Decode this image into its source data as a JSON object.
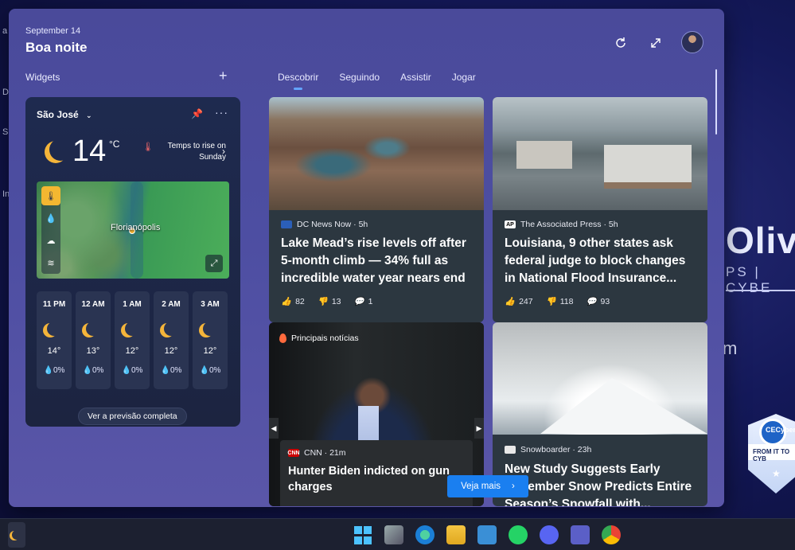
{
  "desktop": {
    "brand_big": "Oliv",
    "brand_sub": "PS | CYBE",
    "brand_m": "m",
    "badge_top": "CECyber",
    "badge_band": "FROM IT TO CYB",
    "edge_letters": [
      "a",
      "D",
      "S",
      "In"
    ]
  },
  "header": {
    "date": "September 14",
    "greeting": "Boa noite"
  },
  "widgets_title": "Widgets",
  "add_widget": "+",
  "tabs": [
    "Descobrir",
    "Seguindo",
    "Assistir",
    "Jogar"
  ],
  "weather": {
    "city": "São José",
    "temp": "14",
    "unit": "°C",
    "note": "Temps to rise on Sunday",
    "map_label": "Florianópolis",
    "hours": [
      {
        "h": "11 PM",
        "t": "14°",
        "p": "0%"
      },
      {
        "h": "12 AM",
        "t": "13°",
        "p": "0%"
      },
      {
        "h": "1 AM",
        "t": "12°",
        "p": "0%"
      },
      {
        "h": "2 AM",
        "t": "12°",
        "p": "0%"
      },
      {
        "h": "3 AM",
        "t": "12°",
        "p": "0%"
      }
    ],
    "full_forecast": "Ver a previsão completa"
  },
  "cards": [
    {
      "source": "DC News Now · 5h",
      "title": "Lake Mead’s rise levels off after 5-month climb — 34% full as incredible water year nears end",
      "likes": "82",
      "dislikes": "13",
      "comments": "1"
    },
    {
      "source": "The Associated Press · 5h",
      "title": "Louisiana, 9 other states ask federal judge to block changes in National Flood Insurance...",
      "likes": "247",
      "dislikes": "118",
      "comments": "93"
    },
    {
      "topic": "Principais notícias",
      "source": "CNN · 21m",
      "title": "Hunter Biden indicted on gun charges"
    },
    {
      "source": "Snowboarder · 23h",
      "title": "New Study Suggests Early November Snow Predicts Entire Season’s Snowfall with..."
    }
  ],
  "veja_mais": "Veja mais",
  "logos": {
    "ap": "AP",
    "cnn": "CNN"
  }
}
